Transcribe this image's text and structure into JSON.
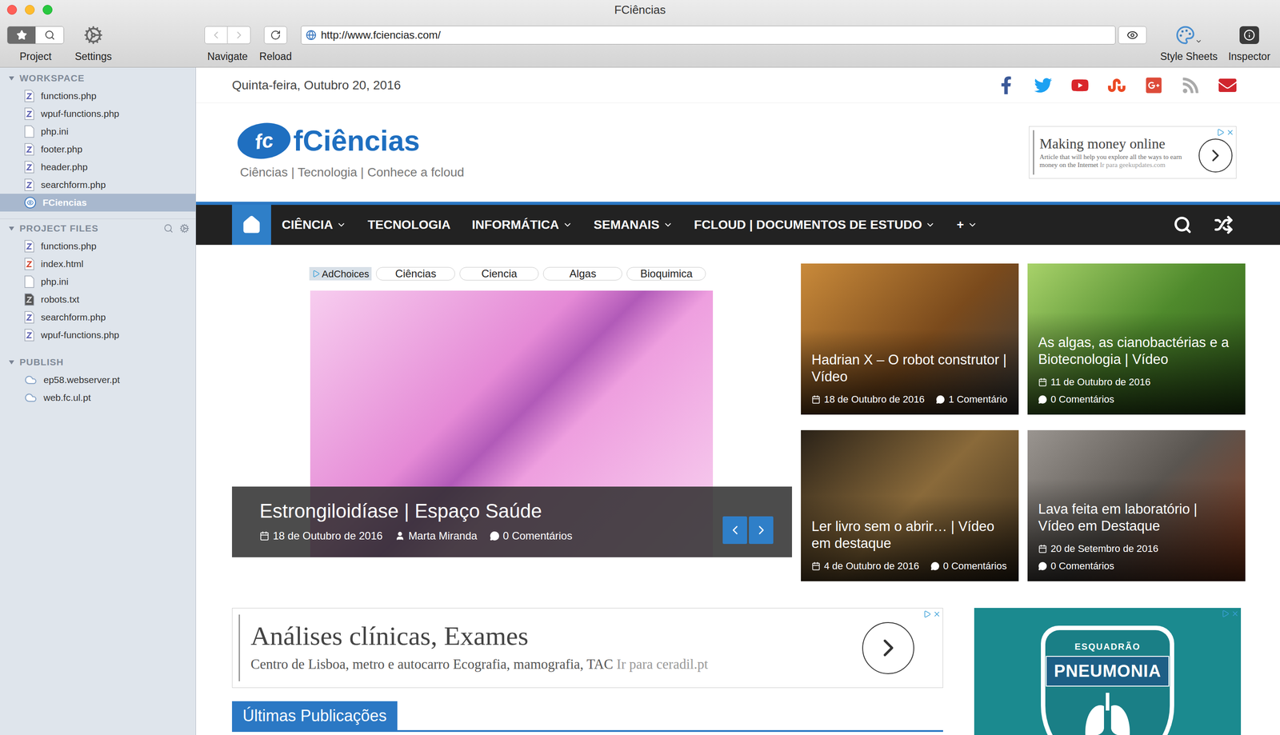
{
  "window": {
    "title": "FCiências"
  },
  "toolbar": {
    "project": {
      "label": "Project",
      "segments": [
        {
          "selected": true
        },
        {
          "selected": false
        }
      ]
    },
    "settings": {
      "label": "Settings"
    },
    "navigate": {
      "label": "Navigate",
      "back_enabled": false,
      "forward_enabled": false
    },
    "reload": {
      "label": "Reload"
    },
    "url": "http://www.fciencias.com/",
    "style_sheets": {
      "label": "Style Sheets"
    },
    "inspector": {
      "label": "Inspector"
    }
  },
  "sidebar": {
    "sections": [
      {
        "title": "WORKSPACE",
        "expanded": true,
        "tools": false,
        "items": [
          {
            "name": "functions.php",
            "kind": "php",
            "selected": false
          },
          {
            "name": "wpuf-functions.php",
            "kind": "php",
            "selected": false
          },
          {
            "name": "php.ini",
            "kind": "text",
            "selected": false
          },
          {
            "name": "footer.php",
            "kind": "php",
            "selected": false
          },
          {
            "name": "header.php",
            "kind": "php",
            "selected": false
          },
          {
            "name": "searchform.php",
            "kind": "php",
            "selected": false
          },
          {
            "name": "FCiencias",
            "kind": "site",
            "selected": true
          }
        ]
      },
      {
        "title": "PROJECT FILES",
        "expanded": true,
        "tools": true,
        "items": [
          {
            "name": "functions.php",
            "kind": "php",
            "selected": false
          },
          {
            "name": "index.html",
            "kind": "html",
            "selected": false
          },
          {
            "name": "php.ini",
            "kind": "text",
            "selected": false
          },
          {
            "name": "robots.txt",
            "kind": "config",
            "selected": false
          },
          {
            "name": "searchform.php",
            "kind": "php",
            "selected": false
          },
          {
            "name": "wpuf-functions.php",
            "kind": "php",
            "selected": false
          }
        ]
      },
      {
        "title": "PUBLISH",
        "expanded": true,
        "tools": false,
        "items": [
          {
            "name": "ep58.webserver.pt",
            "kind": "server",
            "selected": false
          },
          {
            "name": "web.fc.ul.pt",
            "kind": "server",
            "selected": false
          }
        ]
      }
    ]
  },
  "page": {
    "date": "Quinta-feira, Outubro 20, 2016",
    "logo": {
      "mark": "fc",
      "name": "fCiências",
      "tagline": "Ciências | Tecnologia | Conhece a fcloud"
    },
    "header_ad": {
      "title": "Making money online",
      "body": "Article that will help you explore all the ways to earn money on the Internet",
      "link": "Ir para geekupdates.com"
    },
    "nav": {
      "home_selected": true,
      "items": [
        {
          "label": "CIÊNCIA",
          "dropdown": true
        },
        {
          "label": "TECNOLOGIA",
          "dropdown": false
        },
        {
          "label": "INFORMÁTICA",
          "dropdown": true
        },
        {
          "label": "SEMANAIS",
          "dropdown": true
        },
        {
          "label": "FCLOUD | DOCUMENTOS DE ESTUDO",
          "dropdown": true
        },
        {
          "label": "+",
          "dropdown": true
        }
      ]
    },
    "slider": {
      "ad_label": "AdChoices",
      "chips": [
        "Ciências",
        "Ciencia",
        "Algas",
        "Bioquimica"
      ],
      "title": "Estrongiloidíase | Espaço Saúde",
      "date": "18 de Outubro de 2016",
      "author": "Marta Miranda",
      "comments": "0 Comentários"
    },
    "cards": [
      {
        "title": "Hadrian X – O robot construtor | Vídeo",
        "date": "18 de Outubro de 2016",
        "comments": "1 Comentário"
      },
      {
        "title": "As algas, as cianobactérias e a Biotecnologia | Vídeo",
        "date": "11 de Outubro de 2016",
        "comments": "0 Comentários"
      },
      {
        "title": "Ler livro sem o abrir… | Vídeo em destaque",
        "date": "4 de Outubro de 2016",
        "comments": "0 Comentários"
      },
      {
        "title": "Lava feita em laboratório | Vídeo em Destaque",
        "date": "20 de Setembro de 2016",
        "comments": "0 Comentários"
      }
    ],
    "bottom_ad": {
      "title": "Análises clínicas, Exames",
      "body": "Centro de Lisboa, metro e autocarro Ecografia, mamografia, TAC",
      "link": "Ir para ceradil.pt"
    },
    "side_ad": {
      "kicker": "ESQUADRÃO",
      "title": "PNEUMONIA"
    },
    "latest": {
      "title": "Últimas Publicações"
    }
  }
}
